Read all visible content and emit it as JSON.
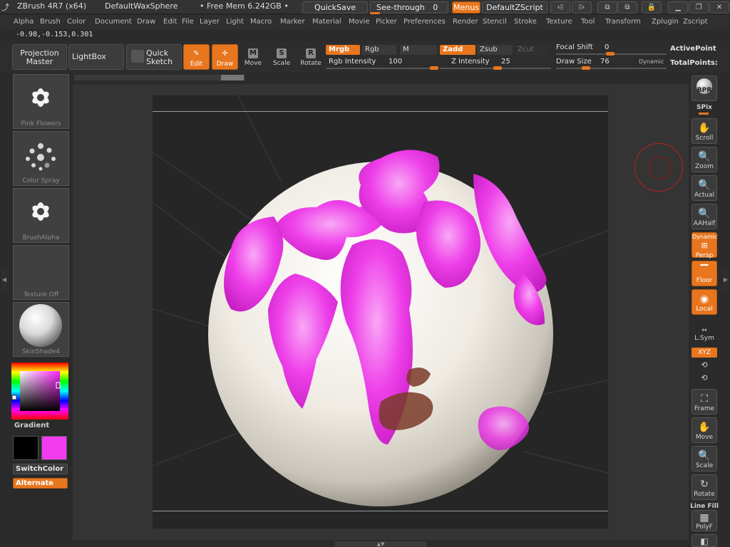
{
  "app": {
    "title": "ZBrush 4R7 (x64)",
    "document": "DefaultWaxSphere",
    "free_mem": "• Free Mem 6.242GB •",
    "quicksave": "QuickSave",
    "see_through_label": "See-through",
    "see_through_value": "0",
    "menus": "Menus",
    "zscript": "DefaultZScript"
  },
  "menu": [
    "Alpha",
    "Brush",
    "Color",
    "Document",
    "Draw",
    "Edit",
    "File",
    "Layer",
    "Light",
    "Macro",
    "Marker",
    "Material",
    "Movie",
    "Picker",
    "Preferences",
    "Render",
    "Stencil",
    "Stroke",
    "Texture",
    "Tool",
    "Transform",
    "Zplugin",
    "Zscript"
  ],
  "coords": "-0.98,-0.153,0.301",
  "toolbar": {
    "projection_master": [
      "Projection",
      "Master"
    ],
    "lightbox": "LightBox",
    "quick_sketch": [
      "Quick",
      "Sketch"
    ],
    "edit": "Edit",
    "draw": "Draw",
    "move": "Move",
    "scale": "Scale",
    "rotate": "Rotate",
    "mrgb": "Mrgb",
    "rgb": "Rgb",
    "m": "M",
    "zadd": "Zadd",
    "zsub": "Zsub",
    "zcut": "Zcut",
    "rgb_intensity_label": "Rgb Intensity",
    "rgb_intensity": "100",
    "rgb_intensity_level": 1.0,
    "z_intensity_label": "Z Intensity",
    "z_intensity": "25",
    "z_intensity_level": 0.25,
    "focal_shift_label": "Focal Shift",
    "focal_shift": "0",
    "draw_size_label": "Draw Size",
    "draw_size": "76",
    "dynamic": "Dynamic",
    "active_points": "ActivePoint",
    "total_points": "TotalPoints:"
  },
  "left": {
    "brush": "Pink Flowers",
    "stroke": "Color Spray",
    "alpha": "BrushAlpha",
    "texture": "Texture Off",
    "material": "SkinShade4",
    "gradient": "Gradient",
    "switch_color": "SwitchColor",
    "alternate": "Alternate",
    "main_color": "#f23cf0",
    "secondary_color": "#000000"
  },
  "right": {
    "bpr": "BPR",
    "spix": "SPix",
    "scroll": "Scroll",
    "zoom": "Zoom",
    "actual": "Actual",
    "aahalf": "AAHalf",
    "dynamic": "Dynamic",
    "persp": "Persp",
    "floor": "Floor",
    "local": "Local",
    "lsym": "L.Sym",
    "xyz": "XYZ",
    "frame": "Frame",
    "move": "Move",
    "scale": "Scale",
    "rotate": "Rotate",
    "line_fill": "Line Fill",
    "polyf": "PolyF"
  },
  "colors": {
    "accent": "#e8761e",
    "paint": "#f23cf0",
    "sphere": "#f2efe8"
  }
}
